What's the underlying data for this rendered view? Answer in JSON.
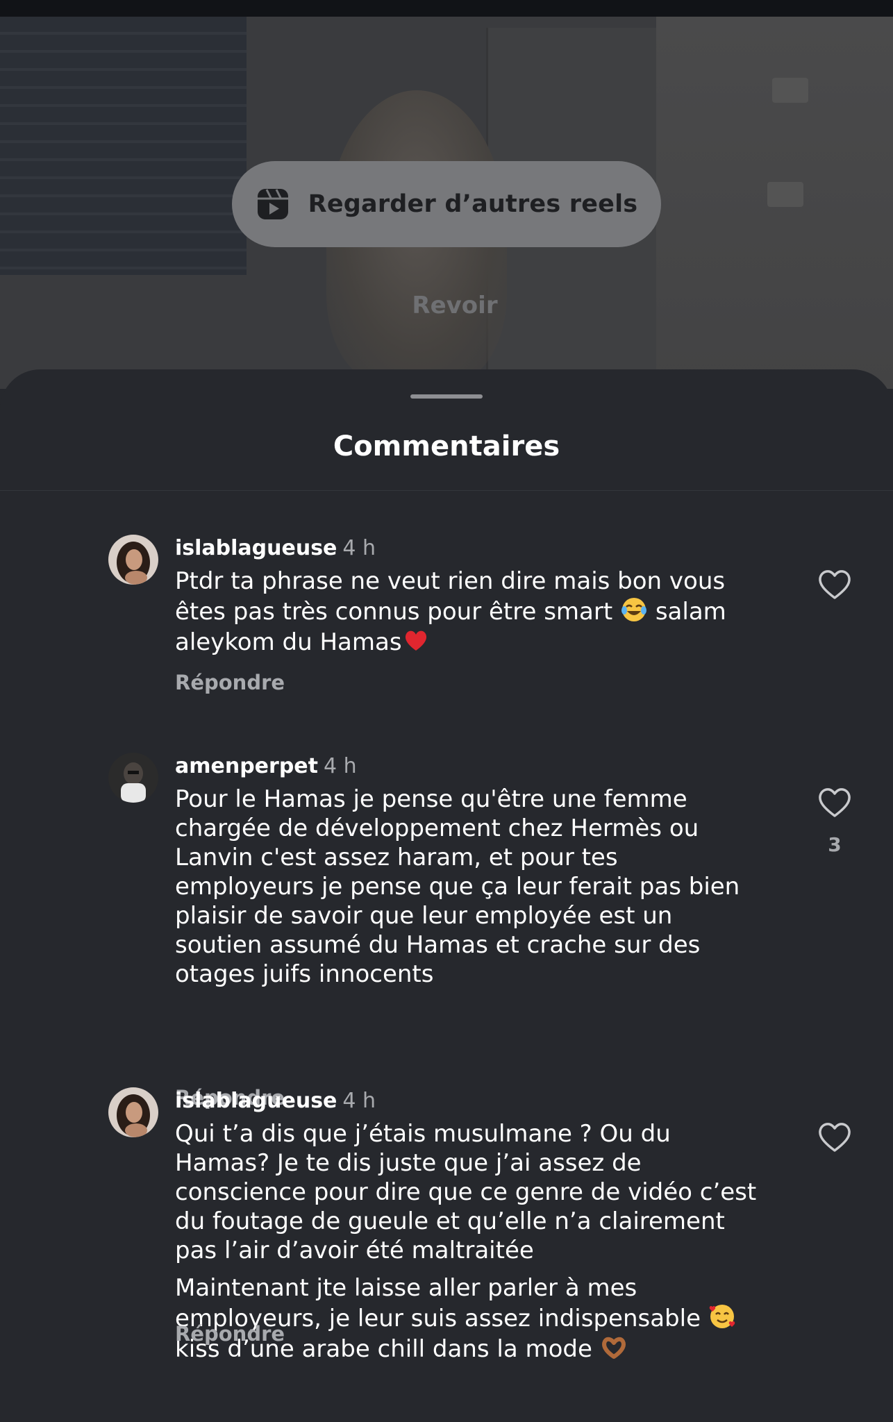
{
  "video": {
    "reels_button_label": "Regarder d’autres reels",
    "replay_label": "Revoir"
  },
  "sheet": {
    "title": "Commentaires"
  },
  "comments": [
    {
      "username": "islablagueuse",
      "time": "4 h",
      "text_1": "Ptdr ta phrase ne veut rien dire mais bon vous êtes pas très connus pour être smart",
      "text_2": "salam aleykom du Hamas",
      "reply_label": "Répondre",
      "emojis": [
        "face-with-tears-of-joy-emoji",
        "red-heart-emoji"
      ]
    },
    {
      "username": "amenperpet",
      "time": "4 h",
      "text": "Pour le Hamas je pense qu'être une femme chargée de développement chez Hermès ou Lanvin c'est assez haram, et pour tes employeurs je pense que ça leur ferait pas bien plaisir de savoir que leur employée est un soutien assumé du Hamas et crache sur des otages juifs innocents",
      "like_count": "3",
      "reply_label": "Répondre"
    },
    {
      "username": "islablagueuse",
      "time": "4 h",
      "paragraph_1": "Qui t’a dis que j’étais musulmane ? Ou du Hamas? Je te dis juste que j’ai assez de conscience pour dire que ce genre de vidéo c’est du foutage de gueule et qu’elle n’a clairement pas l’air d’avoir été maltraitée",
      "paragraph_2a": "Maintenant jte laisse aller parler à mes employeurs, je leur suis assez indispensable",
      "paragraph_2b": "kiss d’une arabe chill dans la mode",
      "reply_label": "Répondre",
      "emojis": [
        "smiling-face-with-hearts-emoji",
        "heart-hands-emoji"
      ]
    }
  ],
  "colors": {
    "sheet_background": "#26282d",
    "secondary_text": "#a8aaae",
    "reels_button_background": "#77787b"
  }
}
